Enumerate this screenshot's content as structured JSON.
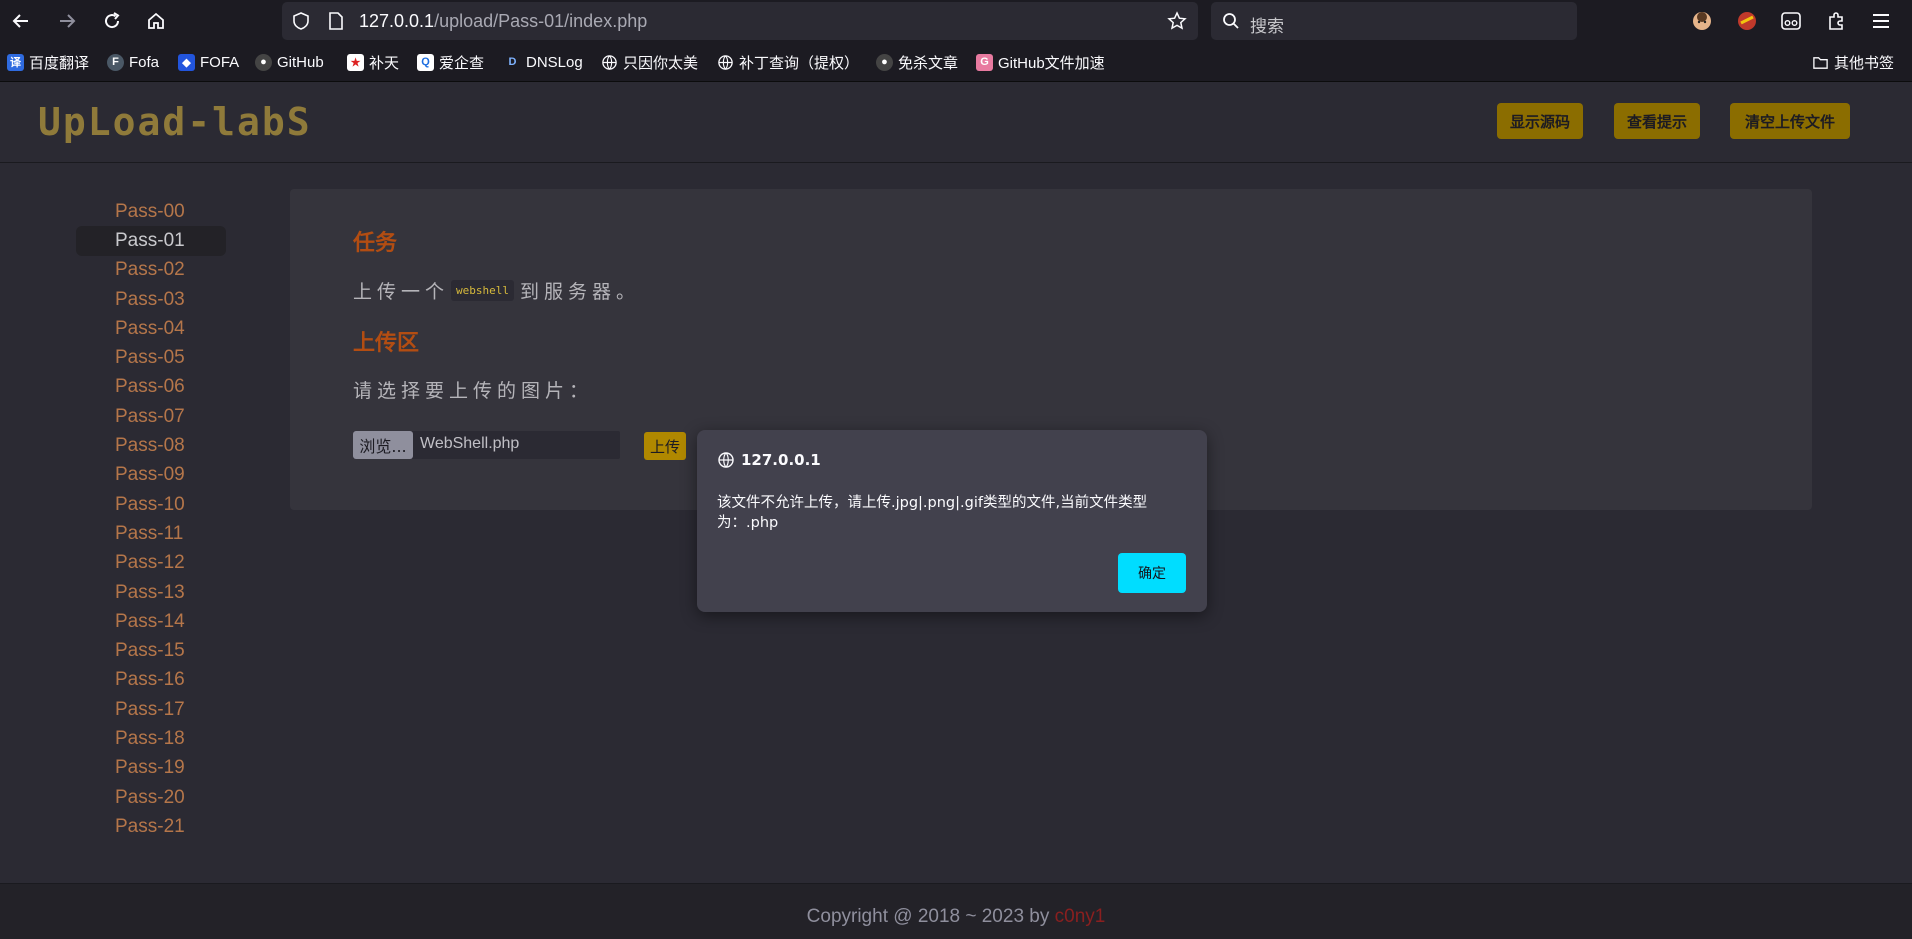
{
  "browser": {
    "url_host": "127.0.0.1",
    "url_path": "/upload/Pass-01/index.php",
    "search_placeholder": "搜索",
    "bookmarks": [
      {
        "label": "百度翻译",
        "icon": "translate-icon",
        "color": "#2f6be0"
      },
      {
        "label": "Fofa",
        "icon": "fofa-icon",
        "color": "#4a5866"
      },
      {
        "label": "FOFA",
        "icon": "fofa-shield-icon",
        "color": "#2255dd"
      },
      {
        "label": "GitHub",
        "icon": "github-icon",
        "color": "#444"
      },
      {
        "label": "补天",
        "icon": "butian-icon",
        "color": "#d22"
      },
      {
        "label": "爱企查",
        "icon": "aiqicha-icon",
        "color": "#fff"
      },
      {
        "label": "DNSLog",
        "icon": "dnslog-icon",
        "color": "#1c1b22"
      },
      {
        "label": "只因你太美",
        "icon": "globe-icon",
        "color": "#1c1b22"
      },
      {
        "label": "补丁查询（提权）",
        "icon": "globe-icon",
        "color": "#1c1b22"
      },
      {
        "label": "免杀文章",
        "icon": "github-icon",
        "color": "#444"
      },
      {
        "label": "GitHub文件加速",
        "icon": "github-accel-icon",
        "color": "#e87aa0"
      }
    ],
    "other_bookmarks": "其他书签"
  },
  "header": {
    "logo": "UpLoad-labS",
    "buttons": [
      "显示源码",
      "查看提示",
      "清空上传文件"
    ],
    "button_color": "#8b6d00"
  },
  "sidebar": {
    "active": "Pass-01",
    "items": [
      "Pass-00",
      "Pass-01",
      "Pass-02",
      "Pass-03",
      "Pass-04",
      "Pass-05",
      "Pass-06",
      "Pass-07",
      "Pass-08",
      "Pass-09",
      "Pass-10",
      "Pass-11",
      "Pass-12",
      "Pass-13",
      "Pass-14",
      "Pass-15",
      "Pass-16",
      "Pass-17",
      "Pass-18",
      "Pass-19",
      "Pass-20",
      "Pass-21"
    ]
  },
  "main": {
    "task_title": "任务",
    "task_text_before": "上传一个",
    "task_code": "webshell",
    "task_text_after": "到服务器。",
    "upload_title": "上传区",
    "upload_prompt": "请选择要上传的图片：",
    "browse_label": "浏览...",
    "file_name": "WebShell.php",
    "upload_button": "上传"
  },
  "dialog": {
    "origin": "127.0.0.1",
    "message": "该文件不允许上传，请上传.jpg|.png|.gif类型的文件,当前文件类型为：.php",
    "ok_label": "确定"
  },
  "footer": {
    "text": "Copyright @ 2018 ~ 2023 by ",
    "author": "c0ny1"
  }
}
